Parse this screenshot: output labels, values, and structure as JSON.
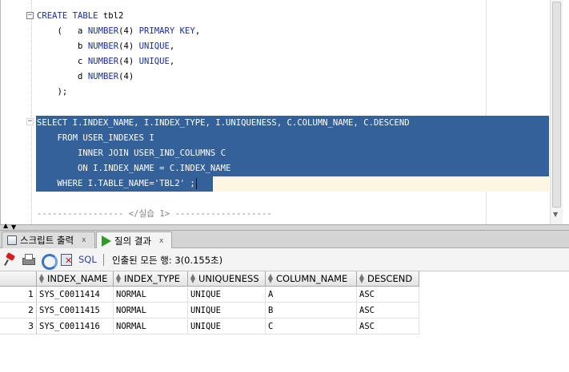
{
  "editor": {
    "fold_marker": "−",
    "create_table": [
      "CREATE TABLE",
      " tbl2"
    ],
    "def_open": [
      "(",
      "a",
      "NUMBER",
      "(4)",
      "PRIMARY KEY",
      ","
    ],
    "def_b": [
      "b",
      "NUMBER",
      "(4)",
      "UNIQUE",
      ","
    ],
    "def_c": [
      "c",
      "NUMBER",
      "(4)",
      "UNIQUE",
      ","
    ],
    "def_d": [
      "d",
      "NUMBER",
      "(4)"
    ],
    "def_close": ");",
    "select_lines": [
      "SELECT I.INDEX_NAME, I.INDEX_TYPE, I.UNIQUENESS, C.COLUMN_NAME, C.DESCEND",
      "    FROM USER_INDEXES I",
      "        INNER JOIN USER_IND_COLUMNS C",
      "        ON I.INDEX_NAME = C.INDEX_NAME",
      "    WHERE I.TABLE_NAME='TBL2' ;"
    ],
    "footer": "----------------- </실습 1> -------------------"
  },
  "tabs": [
    {
      "label": "스크립트 출력",
      "close": "x",
      "icon": "doc-icon"
    },
    {
      "label": "질의 결과",
      "close": "x",
      "icon": "play-icon"
    }
  ],
  "toolbar": {
    "icons": [
      "pin-icon",
      "print-icon",
      "refresh-icon",
      "delete-icon"
    ],
    "sql_label": "SQL",
    "separator": "|",
    "status": "인출된 모든 행: 3(0.155초)"
  },
  "grid": {
    "columns": [
      "INDEX_NAME",
      "INDEX_TYPE",
      "UNIQUENESS",
      "COLUMN_NAME",
      "DESCEND"
    ],
    "rows": [
      {
        "num": "1",
        "cells": [
          "SYS_C0011414",
          "NORMAL",
          "UNIQUE",
          "A",
          "ASC"
        ]
      },
      {
        "num": "2",
        "cells": [
          "SYS_C0011415",
          "NORMAL",
          "UNIQUE",
          "B",
          "ASC"
        ]
      },
      {
        "num": "3",
        "cells": [
          "SYS_C0011416",
          "NORMAL",
          "UNIQUE",
          "C",
          "ASC"
        ]
      }
    ]
  },
  "colors": {
    "keyword": "#1a2ea0",
    "selection": "#35619b",
    "run_icon": "#2e9d24"
  }
}
